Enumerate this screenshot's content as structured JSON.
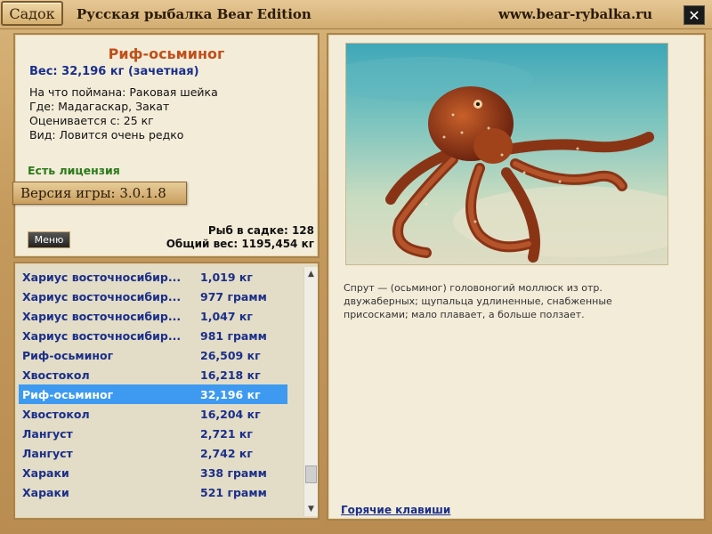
{
  "window": {
    "title_button": "Садок",
    "app_title": "Русская рыбалка Bear Edition",
    "site_url": "www.bear-rybalka.ru",
    "close_label": "✕"
  },
  "fish_info": {
    "name": "Риф-осьминог",
    "weight": "Вес: 32,196 кг (зачетная)",
    "caught_on": "На что поймана: Раковая шейка",
    "location": "Где: Мадагаскар, Закат",
    "valued_from": "Оценивается с: 25 кг",
    "rarity": "Вид: Ловится очень редко",
    "license": "Есть лицензия",
    "version": "Версия игры: 3.0.1.8",
    "menu_label": "Меню",
    "fish_count": "Рыб в садке: 128",
    "total_weight": "Общий вес: 1195,454 кг"
  },
  "fish_list": [
    {
      "name": "Хариус восточносибир...",
      "weight": "1,019 кг"
    },
    {
      "name": "Хариус восточносибир...",
      "weight": "977 грамм"
    },
    {
      "name": "Хариус восточносибир...",
      "weight": "1,047 кг"
    },
    {
      "name": "Хариус восточносибир...",
      "weight": "981 грамм"
    },
    {
      "name": "Риф-осьминог",
      "weight": "26,509 кг"
    },
    {
      "name": "Хвостокол",
      "weight": "16,218 кг"
    },
    {
      "name": "Риф-осьминог",
      "weight": "32,196 кг",
      "selected": true
    },
    {
      "name": "Хвостокол",
      "weight": "16,204 кг"
    },
    {
      "name": "Лангуст",
      "weight": "2,721 кг"
    },
    {
      "name": "Лангуст",
      "weight": "2,742 кг"
    },
    {
      "name": "Хараки",
      "weight": "338 грамм"
    },
    {
      "name": "Хараки",
      "weight": "521 грамм"
    }
  ],
  "scroll_position": 0.91,
  "photo": {
    "icon": "octopus-photo"
  },
  "description": "Спрут — (осьминог) головоногий моллюск из отр. двужаберных; щупальца удлиненные, снабженные присосками; мало плавает, а больше ползает.",
  "hotkeys_label": "Горячие клавиши",
  "colors": {
    "fish_name": "#c0501a",
    "weight": "#1a2f8a",
    "license": "#2a7a1a",
    "selection": "#3d9af0"
  }
}
